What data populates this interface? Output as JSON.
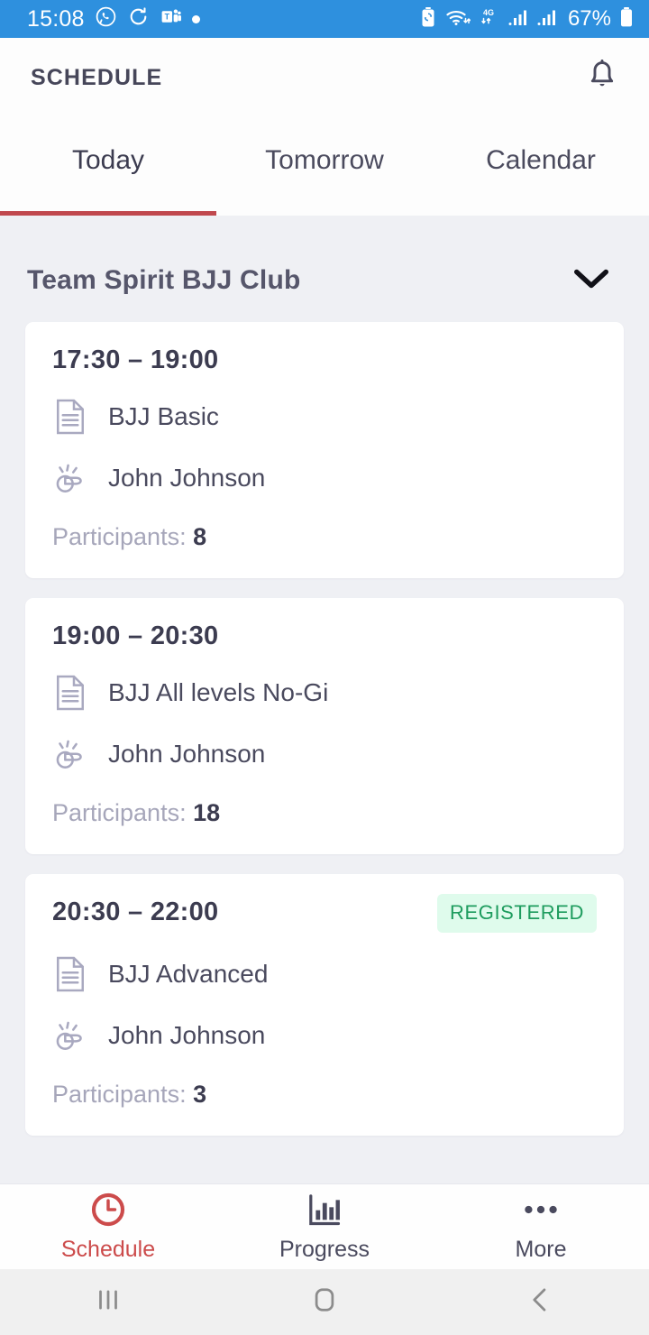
{
  "status_bar": {
    "time": "15:08",
    "battery_percent": "67%",
    "network": "4G",
    "left_icons": [
      "whatsapp-icon",
      "sync-icon",
      "teams-icon",
      "dot-indicator"
    ],
    "right_icons": [
      "battery-saver-icon",
      "wifi-icon",
      "mobile-data-4g-icon",
      "signal-sim1-icon",
      "signal-sim2-icon",
      "battery-icon"
    ],
    "background_color": "#2E90DE"
  },
  "app_bar": {
    "title": "SCHEDULE",
    "notification_icon": "bell-icon"
  },
  "tabs": {
    "items": [
      {
        "label": "Today",
        "active": true
      },
      {
        "label": "Tomorrow",
        "active": false
      },
      {
        "label": "Calendar",
        "active": false
      }
    ],
    "active_index": 0,
    "indicator_color": "#C0484D"
  },
  "club": {
    "name": "Team Spirit BJJ Club",
    "expand_icon": "chevron-down-icon"
  },
  "classes": [
    {
      "time": "17:30 – 19:00",
      "title": "BJJ Basic",
      "instructor": "John Johnson",
      "participants_label": "Participants:",
      "participants_count": "8",
      "badge": null
    },
    {
      "time": "19:00 – 20:30",
      "title": "BJJ All levels No-Gi",
      "instructor": "John Johnson",
      "participants_label": "Participants:",
      "participants_count": "18",
      "badge": null
    },
    {
      "time": "20:30 – 22:00",
      "title": "BJJ Advanced",
      "instructor": "John Johnson",
      "participants_label": "Participants:",
      "participants_count": "3",
      "badge": "REGISTERED"
    }
  ],
  "badge_colors": {
    "registered_background": "#DFFBEC",
    "registered_text": "#1E9C5E"
  },
  "bottom_nav": {
    "items": [
      {
        "label": "Schedule",
        "icon": "clock-icon",
        "active": true
      },
      {
        "label": "Progress",
        "icon": "bar-chart-icon",
        "active": false
      },
      {
        "label": "More",
        "icon": "ellipsis-icon",
        "active": false
      }
    ],
    "active_color": "#CC4B4B"
  },
  "system_nav": {
    "recents_icon": "recents-icon",
    "home_icon": "home-icon",
    "back_icon": "back-icon"
  }
}
